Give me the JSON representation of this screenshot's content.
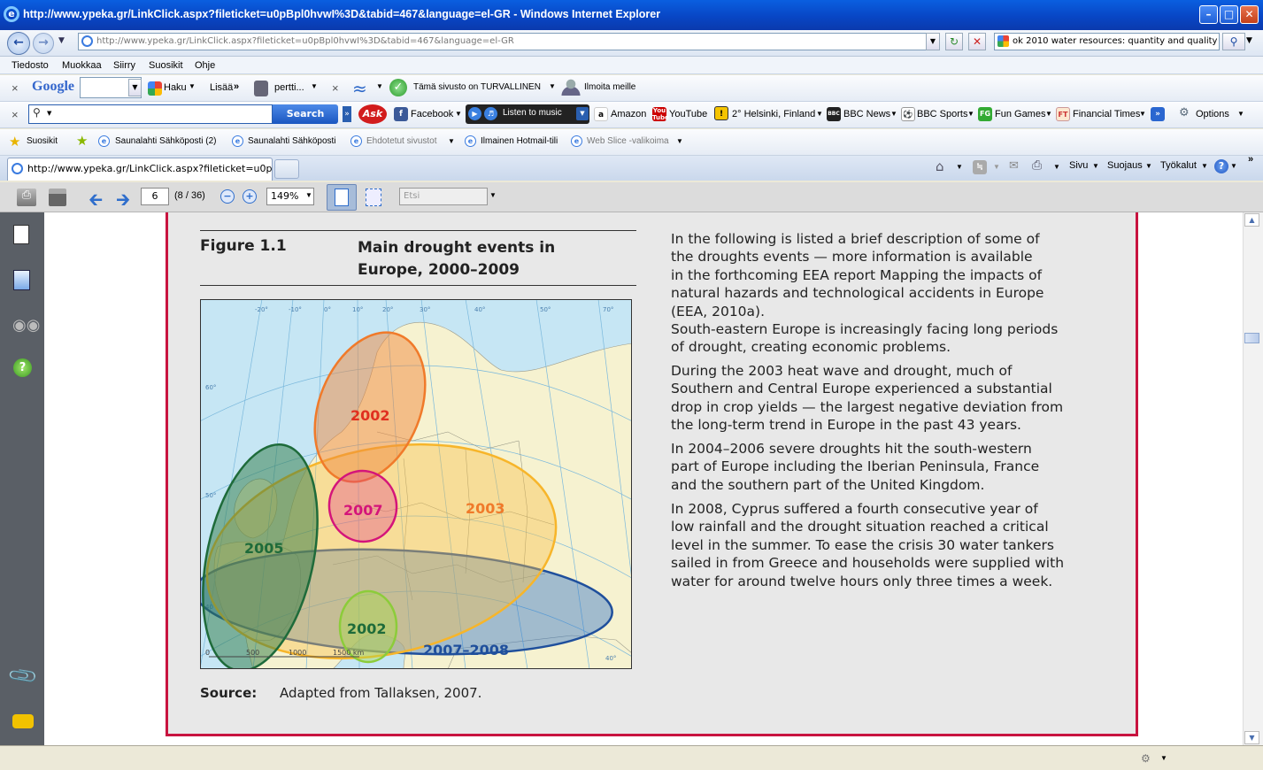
{
  "window": {
    "title": "http://www.ypeka.gr/LinkClick.aspx?fileticket=u0pBpl0hvwI%3D&tabid=467&language=el-GR - Windows Internet Explorer",
    "minimize": "–",
    "maximize": "□",
    "close": "✕"
  },
  "nav": {
    "address": "http://www.ypeka.gr/LinkClick.aspx?fileticket=u0pBpl0hvwI%3D&tabid=467&language=el-GR",
    "search_value": "ok 2010 water resources: quantity and quality"
  },
  "menu": [
    "Tiedosto",
    "Muokkaa",
    "Siirry",
    "Suosikit",
    "Ohje"
  ],
  "google_bar": {
    "logo": "Google",
    "haku": "Haku",
    "lisaa": "Lisää",
    "user": "pertti...",
    "secure": "Tämä sivusto on TURVALLINEN",
    "report": "Ilmoita meille"
  },
  "ask_bar": {
    "search_button": "Search",
    "facebook": "Facebook",
    "listen": "Listen to music",
    "amazon": "Amazon",
    "youtube": "YouTube",
    "weather": "2° Helsinki, Finland",
    "bbc_news": "BBC News",
    "bbc_sports": "BBC Sports",
    "fun_games": "Fun Games",
    "ft": "Financial Times",
    "options": "Options"
  },
  "favorites": {
    "label": "Suosikit",
    "items": [
      "Saunalahti Sähköposti (2)",
      "Saunalahti Sähköposti",
      "Ehdotetut sivustot",
      "Ilmainen Hotmail-tili",
      "Web Slice -valikoima"
    ]
  },
  "tab": {
    "label": "http://www.ypeka.gr/LinkClick.aspx?fileticket=u0pBpl...",
    "cmd": [
      "Sivu",
      "Suojaus",
      "Työkalut"
    ]
  },
  "pdf": {
    "page": "6",
    "page_total": "(8 / 36)",
    "zoom": "149%",
    "find_placeholder": "Etsi"
  },
  "figure": {
    "label": "Figure 1.1",
    "title_line1": "Main drought events in",
    "title_line2": "Europe, 2000–2009",
    "source_label": "Source:",
    "source_text": "Adapted from Tallaksen, 2007.",
    "map_labels": {
      "y2002_north": "2002",
      "y2007": "2007",
      "y2003": "2003",
      "y2005": "2005",
      "y2002_south": "2002",
      "y2007_2008": "2007–2008"
    },
    "scale": [
      "0",
      "500",
      "1000",
      "1500 km"
    ],
    "graticule": [
      "-20°",
      "-10°",
      "0°",
      "10°",
      "20°",
      "30°",
      "40°",
      "50°",
      "60°",
      "70°",
      "60°",
      "50°",
      "40°",
      "30°",
      "40°"
    ]
  },
  "text": {
    "p1": [
      "In the following is listed a brief description of some of",
      "the droughts events — more information is available",
      "in the forthcoming EEA report Mapping the impacts of",
      "natural hazards and technological accidents in Europe",
      "(EEA, 2010a)."
    ],
    "p2": [
      "South-eastern Europe is increasingly facing long periods",
      "of drought, creating economic problems."
    ],
    "p3": [
      "During the 2003 heat wave and drought, much of",
      "Southern and Central Europe experienced a substantial",
      "drop in crop yields — the largest negative deviation from",
      "the long-term trend in Europe in the past 43 years."
    ],
    "p4": [
      "In 2004–2006 severe droughts hit the south-western",
      "part of Europe including the Iberian Peninsula, France",
      "and the southern part of the United Kingdom."
    ],
    "p5": [
      "In 2008, Cyprus suffered a fourth consecutive year of",
      "low rainfall and the drought situation reached a critical",
      "level in the summer. To ease the crisis 30 water tankers",
      "sailed in from Greece and households were supplied with",
      "water for around twelve hours only three times a week."
    ]
  },
  "colors": {
    "frame": "#c8133f",
    "d2002n": "#f07a2a",
    "d2003": "#f7b52a",
    "d2005": "#1e6b3a",
    "d2007": "#d4147a",
    "d2002s": "#8ccc3a",
    "d2007_2008": "#1f4f9c"
  }
}
